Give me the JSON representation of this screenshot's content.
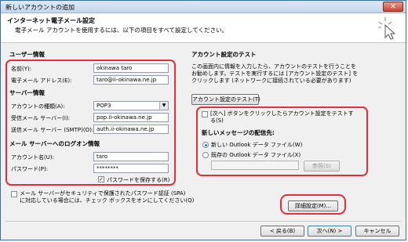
{
  "window": {
    "title": "新しいアカウントの追加",
    "close_glyph": "✕"
  },
  "header": {
    "title": "インターネット電子メール設定",
    "subtitle": "電子メール アカウントを使用するには、以下の項目をすべて設定してください。"
  },
  "user_info": {
    "heading": "ユーザー情報",
    "name_label": "名前(Y):",
    "name_value": "okinawa taro",
    "email_label": "電子メール アドレス(E):",
    "email_value": "taro@ii-okinawa.ne.jp"
  },
  "server_info": {
    "heading": "サーバー情報",
    "account_type_label": "アカウントの種類(A):",
    "account_type_value": "POP3",
    "incoming_label": "受信メール サーバー(I):",
    "incoming_value": "pop.ii-okinawa.ne.jp",
    "outgoing_label": "送信メール サーバー (SMTP)(O):",
    "outgoing_value": "auth.ii-okinawa.ne.jp"
  },
  "logon_info": {
    "heading": "メール サーバーへのログオン情報",
    "account_name_label": "アカウント名(U):",
    "account_name_value": "taro",
    "password_label": "パスワード(P):",
    "password_value": "********",
    "save_password_label": "パスワードを保存する(R)",
    "spa_label_line1": "メール サーバーがセキュリティで保護されたパスワード認証 (SPA)",
    "spa_label_line2": "に対応している場合には、チェック ボックスをオンにしてください(Q)"
  },
  "test": {
    "heading": "アカウント設定のテスト",
    "desc_line1": "この画面内に情報を入力したら、アカウントのテストを行うことを",
    "desc_line2": "お勧めします。テストを実行するには [アカウント設定のテスト] を",
    "desc_line3": "クリックします (ネットワークに接続されている必要があります)",
    "test_button": "アカウント設定のテスト(T)",
    "auto_test_line1": "[次へ] ボタンをクリックしたらアカウント設定をテストす",
    "auto_test_line2": "る(S)"
  },
  "delivery": {
    "heading": "新しいメッセージの配信先:",
    "option_new": "新しい Outlook データ ファイル(W)",
    "option_existing": "既存の Outlook データ ファイル(X)",
    "browse_button": "参照(S)"
  },
  "buttons": {
    "more_settings": "詳細設定(M)...",
    "back": "< 戻る(B)",
    "next": "次へ(N) >",
    "cancel": "キャンセル"
  },
  "colors": {
    "highlight": "#e0303c",
    "accent": "#2e6fc4"
  }
}
